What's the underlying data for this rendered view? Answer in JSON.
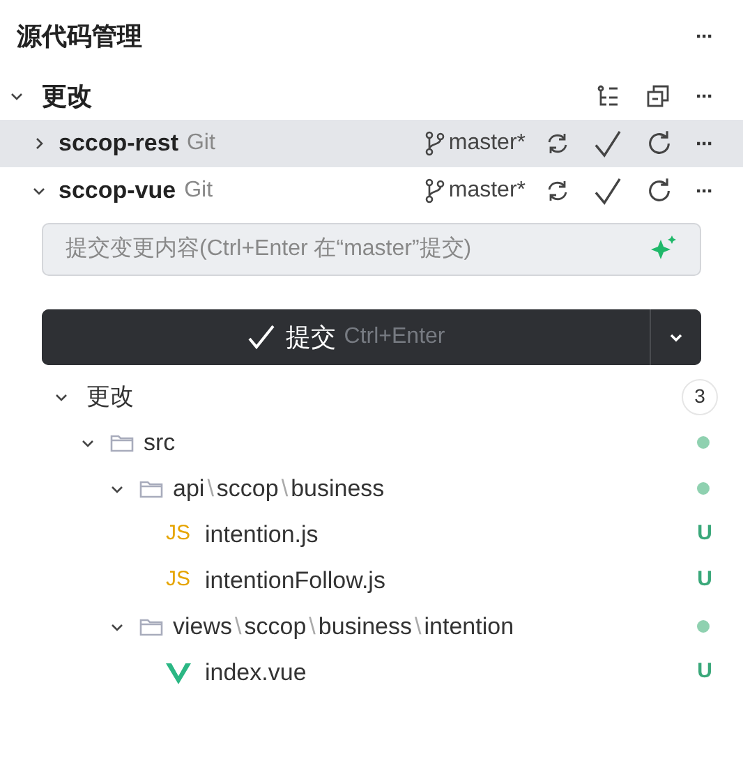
{
  "panel": {
    "title": "源代码管理",
    "more": "···"
  },
  "section": {
    "title": "更改",
    "expanded": true,
    "more": "···"
  },
  "repositories": [
    {
      "name": "sccop-rest",
      "type": "Git",
      "branch": "master*",
      "expanded": false,
      "selected": true,
      "more": "···"
    },
    {
      "name": "sccop-vue",
      "type": "Git",
      "branch": "master*",
      "expanded": true,
      "selected": false,
      "more": "···"
    }
  ],
  "commit_box": {
    "placeholder": "提交变更内容(Ctrl+Enter 在“master”提交)"
  },
  "commit_button": {
    "label": "提交",
    "shortcut": "Ctrl+Enter"
  },
  "changes": {
    "title": "更改",
    "count": "3",
    "expanded": true,
    "children": [
      {
        "kind": "folder",
        "segments": [
          "src"
        ],
        "expanded": true,
        "modified": true,
        "children": [
          {
            "kind": "folder",
            "segments": [
              "api",
              "sccop",
              "business"
            ],
            "expanded": true,
            "modified": true,
            "children": [
              {
                "kind": "js",
                "icon_text": "JS",
                "segments": [
                  "intention.js"
                ],
                "status": "U"
              },
              {
                "kind": "js",
                "icon_text": "JS",
                "segments": [
                  "intentionFollow.js"
                ],
                "status": "U"
              }
            ]
          },
          {
            "kind": "folder",
            "segments": [
              "views",
              "sccop",
              "business",
              "intention"
            ],
            "expanded": true,
            "modified": true,
            "children": [
              {
                "kind": "vue",
                "segments": [
                  "index.vue"
                ],
                "status": "U"
              }
            ]
          }
        ]
      }
    ]
  },
  "path_separator": "\\"
}
